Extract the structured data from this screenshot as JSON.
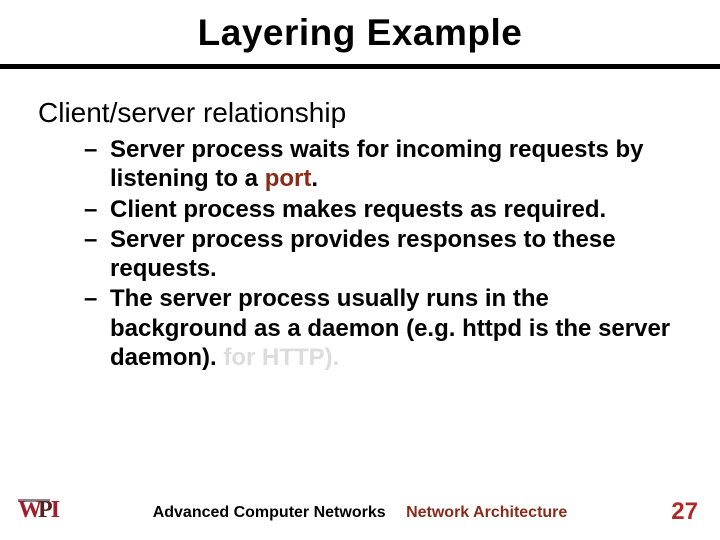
{
  "title": "Layering Example",
  "heading": "Client/server relationship",
  "bullets": {
    "b1_pre": "Server process waits for incoming requests by listening to a ",
    "b1_port": "port",
    "b1_post": ".",
    "b2": "Client process makes requests as required.",
    "b3": "Server process provides responses to these requests.",
    "b4_main": "The server process usually runs in the background as a daemon (e.g. httpd is the server daemon).",
    "b4_faded": " for HTTP)."
  },
  "footer": {
    "logo_w": "W",
    "logo_p": "P",
    "logo_i": "I",
    "course": "Advanced Computer Networks",
    "topic": "Network Architecture",
    "page": "27"
  }
}
